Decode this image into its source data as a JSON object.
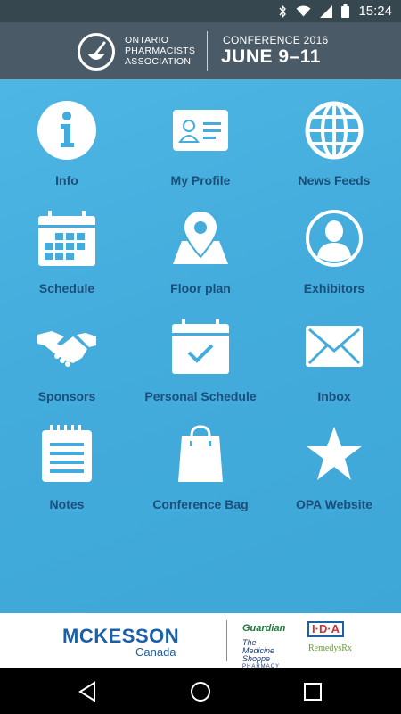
{
  "status_bar": {
    "time": "15:24",
    "icons": [
      "bluetooth-icon",
      "wifi-icon",
      "signal-icon",
      "battery-icon"
    ]
  },
  "header": {
    "org_name_lines": [
      "ONTARIO",
      "PHARMACISTS",
      "ASSOCIATION"
    ],
    "conference_label": "CONFERENCE 2016",
    "conference_date": "JUNE 9–11"
  },
  "menu": [
    {
      "label": "Info",
      "icon": "info-icon"
    },
    {
      "label": "My Profile",
      "icon": "profile-card-icon"
    },
    {
      "label": "News Feeds",
      "icon": "globe-icon"
    },
    {
      "label": "Schedule",
      "icon": "calendar-icon"
    },
    {
      "label": "Floor plan",
      "icon": "map-pin-icon"
    },
    {
      "label": "Exhibitors",
      "icon": "person-icon"
    },
    {
      "label": "Sponsors",
      "icon": "handshake-icon"
    },
    {
      "label": "Personal Schedule",
      "icon": "calendar-check-icon"
    },
    {
      "label": "Inbox",
      "icon": "envelope-icon"
    },
    {
      "label": "Notes",
      "icon": "notepad-icon"
    },
    {
      "label": "Conference Bag",
      "icon": "shopping-bag-icon"
    },
    {
      "label": "OPA Website",
      "icon": "star-icon"
    }
  ],
  "sponsors": {
    "mckesson": "MCKESSON",
    "mckesson_sub": "Canada",
    "guardian": "Guardian",
    "ida": "I·D·A",
    "medicine_shoppe_lines": [
      "The",
      "Medicine",
      "Shoppe",
      "PHARMACY"
    ],
    "remedys": "RemedysRx"
  },
  "nav": [
    "back-icon",
    "home-icon",
    "recents-icon"
  ],
  "colors": {
    "background": "#43acdc",
    "header": "#4a5a66",
    "label": "#1b4f7a",
    "brand_blue": "#1a5fa8"
  }
}
